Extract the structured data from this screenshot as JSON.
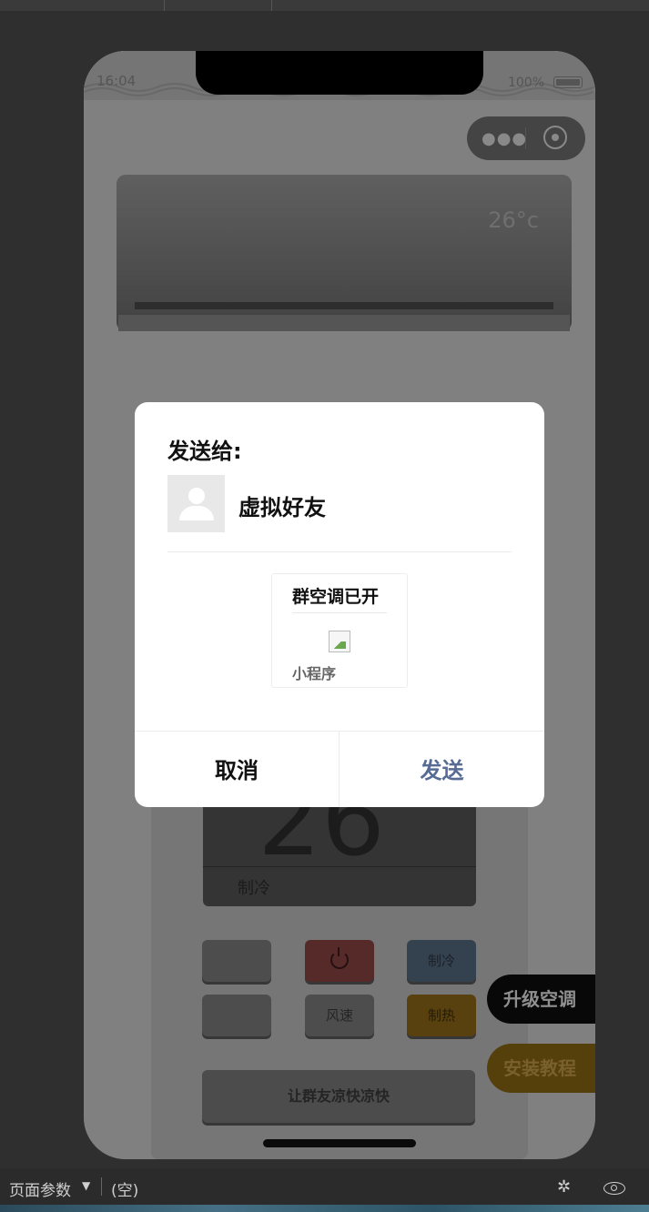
{
  "status_bar": {
    "time": "16:04",
    "battery": "100%"
  },
  "air_conditioner": {
    "temperature": "26°c"
  },
  "remote": {
    "display_temp": "26",
    "display_mode": "制冷",
    "buttons": {
      "fan_speed": "风速",
      "cool": "制冷",
      "heat": "制热"
    },
    "share_label": "让群友凉快凉快"
  },
  "floating": {
    "upgrade_label": "升级空调",
    "tutorial_label": "安装教程"
  },
  "share_dialog": {
    "title": "发送给:",
    "friend_name": "虚拟好友",
    "card_title": "群空调已开",
    "card_footer": "小程序",
    "cancel_label": "取消",
    "send_label": "发送"
  },
  "devtools_bar": {
    "page_params_label": "页面参数",
    "page_params_value": "(空)"
  },
  "colors": {
    "send_accent": "#576b95",
    "overlay": "rgba(0,0,0,0.38)"
  }
}
